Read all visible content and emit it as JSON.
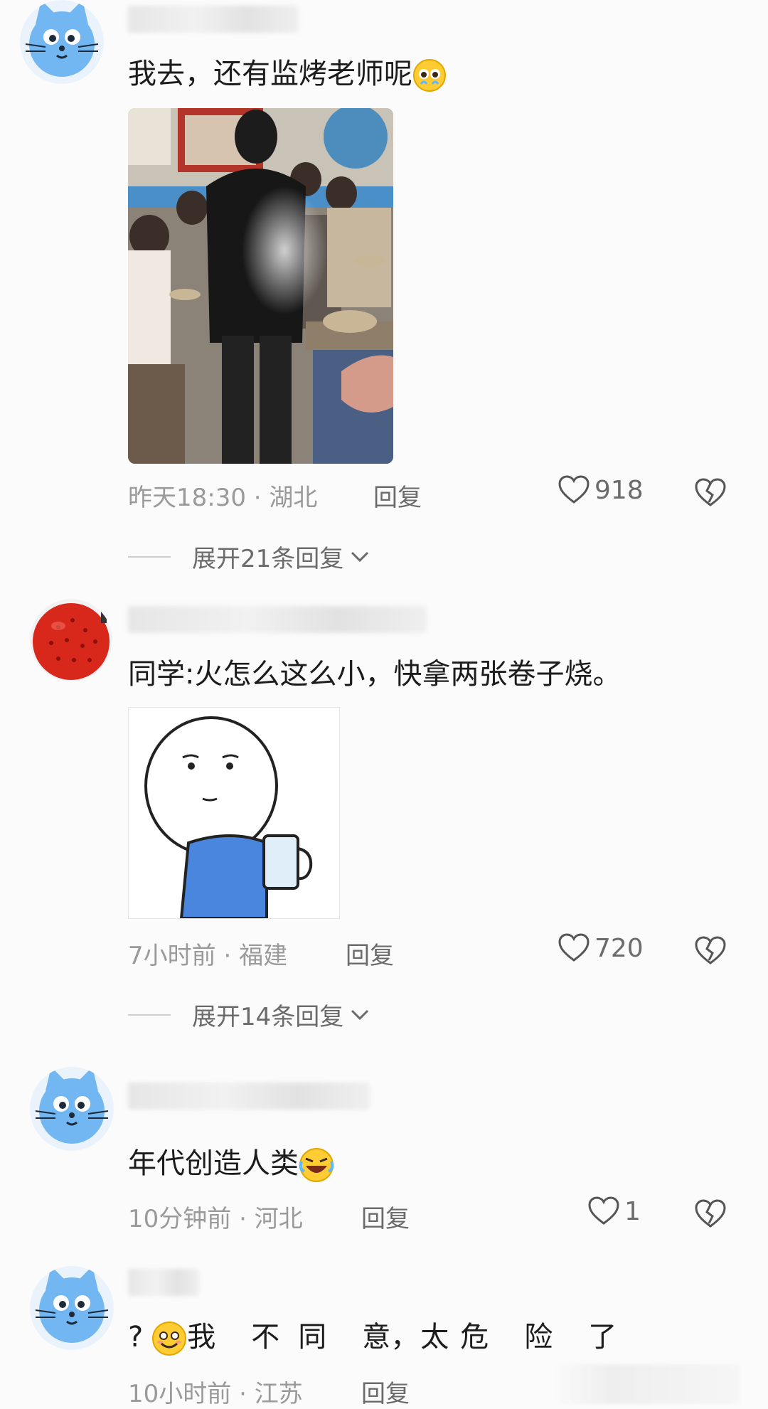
{
  "comments": [
    {
      "text": "我去，还有监烤老师呢",
      "emoji": "pleading-face",
      "time": "昨天18:30",
      "location": "湖北",
      "reply": "回复",
      "likes": "918",
      "expand": "展开21条回复"
    },
    {
      "text": "同学:火怎么这么小，快拿两张卷子烧。",
      "time": "7小时前",
      "location": "福建",
      "reply": "回复",
      "likes": "720",
      "expand": "展开14条回复"
    },
    {
      "text": "年代创造人类",
      "emoji": "rolling-laughing-face",
      "time": "10分钟前",
      "location": "河北",
      "reply": "回复",
      "likes": "1"
    },
    {
      "prefix": "?",
      "emoji": "smiling-face",
      "chars": [
        "我",
        "不",
        "同",
        "意，",
        "太",
        "危",
        "险",
        "了"
      ],
      "time": "10小时前",
      "location": "江苏",
      "reply": "回复"
    }
  ],
  "separator": "·",
  "colors": {
    "avatar_blue": "#73b7f2",
    "lychee_red": "#d8281c",
    "meme_shirt": "#4a86dd",
    "text": "#1c1c1c",
    "meta": "#9a9a9a"
  }
}
